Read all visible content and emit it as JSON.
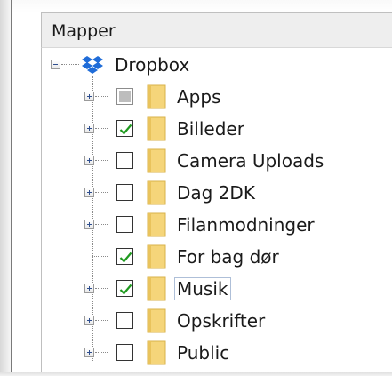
{
  "panel": {
    "title": "Mapper"
  },
  "root": {
    "label": "Dropbox",
    "icon": "dropbox-icon",
    "expanded": true,
    "brand_color": "#1f6cd8"
  },
  "folders": [
    {
      "label": "Apps",
      "state": "indeterminate",
      "expandable": true
    },
    {
      "label": "Billeder",
      "state": "checked",
      "expandable": true
    },
    {
      "label": "Camera Uploads",
      "state": "unchecked",
      "expandable": true
    },
    {
      "label": "Dag 2DK",
      "state": "unchecked",
      "expandable": true
    },
    {
      "label": "Filanmodninger",
      "state": "unchecked",
      "expandable": true
    },
    {
      "label": "For bag dør",
      "state": "checked",
      "expandable": false
    },
    {
      "label": "Musik",
      "state": "checked",
      "expandable": true,
      "focused": true
    },
    {
      "label": "Opskrifter",
      "state": "unchecked",
      "expandable": true
    },
    {
      "label": "Public",
      "state": "unchecked",
      "expandable": true
    }
  ],
  "colors": {
    "check": "#1f9a1f",
    "folder": "#f5d57a",
    "folder_edge": "#d8b24a"
  }
}
